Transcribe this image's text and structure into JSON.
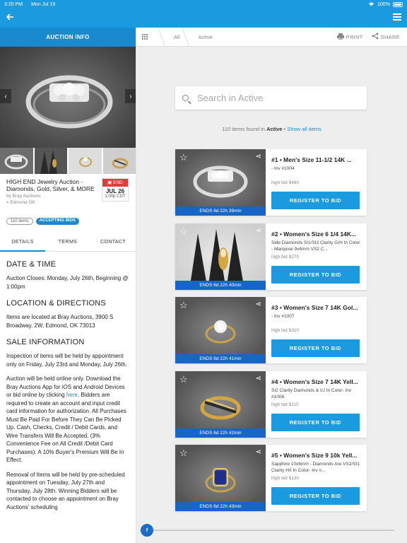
{
  "status": {
    "time": "3:20 PM",
    "date": "Mon Jul 19",
    "battery": "100%"
  },
  "left": {
    "header": "AUCTION INFO",
    "title": "HIGH END Jewelry Auction - Diamonds, Gold, Silver, & MORE",
    "by": "by Bray Auctions",
    "location": "Edmond OK",
    "end": {
      "label": "END",
      "date": "JUL 26",
      "time": "1:00p CDT"
    },
    "badges": {
      "items": "110 items",
      "status": "ACCEPTING BIDS"
    },
    "tabs": [
      "DETAILS",
      "TERMS",
      "CONTACT"
    ],
    "sections": {
      "date_heading": "DATE & TIME",
      "date_text": "Auction Closes: Monday, July 26th, Beginning @ 1:00pm",
      "location_heading": "LOCATION & DIRECTIONS",
      "location_text": "Items are located at Bray Auctions, 3900 S Broadway, 2W, Edmond, OK 73013",
      "sale_heading": "SALE INFORMATION",
      "sale_p1": "Inspection of items will be held by appointment only on Friday, July 23rd and Monday, July 26th.",
      "sale_p2a": "Auction will be held online only. Download the Bray Auctions App for iOS and Android Devices or bid online by clicking ",
      "sale_p2_link": "here",
      "sale_p2b": ". Bidders are required to create an account and input credit card information for authorization. All Purchases Must Be Paid For Before They Can Be Picked Up. Cash, Checks, Credit / Debit Cards, and Wire Transfers Will Be Accepted. (3% Convenience Fee on All Credit /Debit Card Purchases). A 10% Buyer's Premium Will Be In Effect.",
      "sale_p3": "Removal of Items will be held by pre-scheduled appointment on Tuesday, July 27th and Thursday, July 28th. Winning Bidders will be contacted to choose an appointment on Bray Auctions' scheduling"
    }
  },
  "right": {
    "crumbs": [
      "All",
      "Active"
    ],
    "print": "PRINT",
    "share": "SHARE",
    "search_placeholder": "Search in Active",
    "found": {
      "pre": "110 items found in ",
      "filter": "Active",
      "link": "Show all items"
    },
    "slider_label": "f",
    "lots": [
      {
        "title": "#1 • Men's Size 11-1/2 14K ...",
        "desc": "- Inv #1004",
        "bid": "high bid $460",
        "ends": "ENDS 6d 22h 39min",
        "button": "REGISTER TO BID"
      },
      {
        "title": "#2 • Women's Size 6 1/4 14K...",
        "desc": "Side Diamonds SI1/SI2 Clarity G/H In Color - Marquise 9x4mm VS2 C...",
        "bid": "high bid $270",
        "ends": "ENDS 6d 22h 40min",
        "button": "REGISTER TO BID"
      },
      {
        "title": "#3 • Women's Size 7 14K Gol...",
        "desc": "- Inv #1007",
        "bid": "high bid $310",
        "ends": "ENDS 6d 22h 41min",
        "button": "REGISTER TO BID"
      },
      {
        "title": "#4 • Women's Size 7 14K Yell...",
        "desc": "SI2 Clarity Diamonds & I/J In Color- Inv #1006",
        "bid": "high bid $110",
        "ends": "ENDS 6d 22h 42min",
        "button": "REGISTER TO BID"
      },
      {
        "title": "#5 • Women's Size 9 10k Yell...",
        "desc": "Sapphire 10x8mm - Diamonds Are VS2/SI1 Clarity H/I In Color- Inv #...",
        "bid": "high bid $130",
        "ends": "ENDS 6d 22h 43min",
        "button": "REGISTER TO BID"
      }
    ]
  }
}
